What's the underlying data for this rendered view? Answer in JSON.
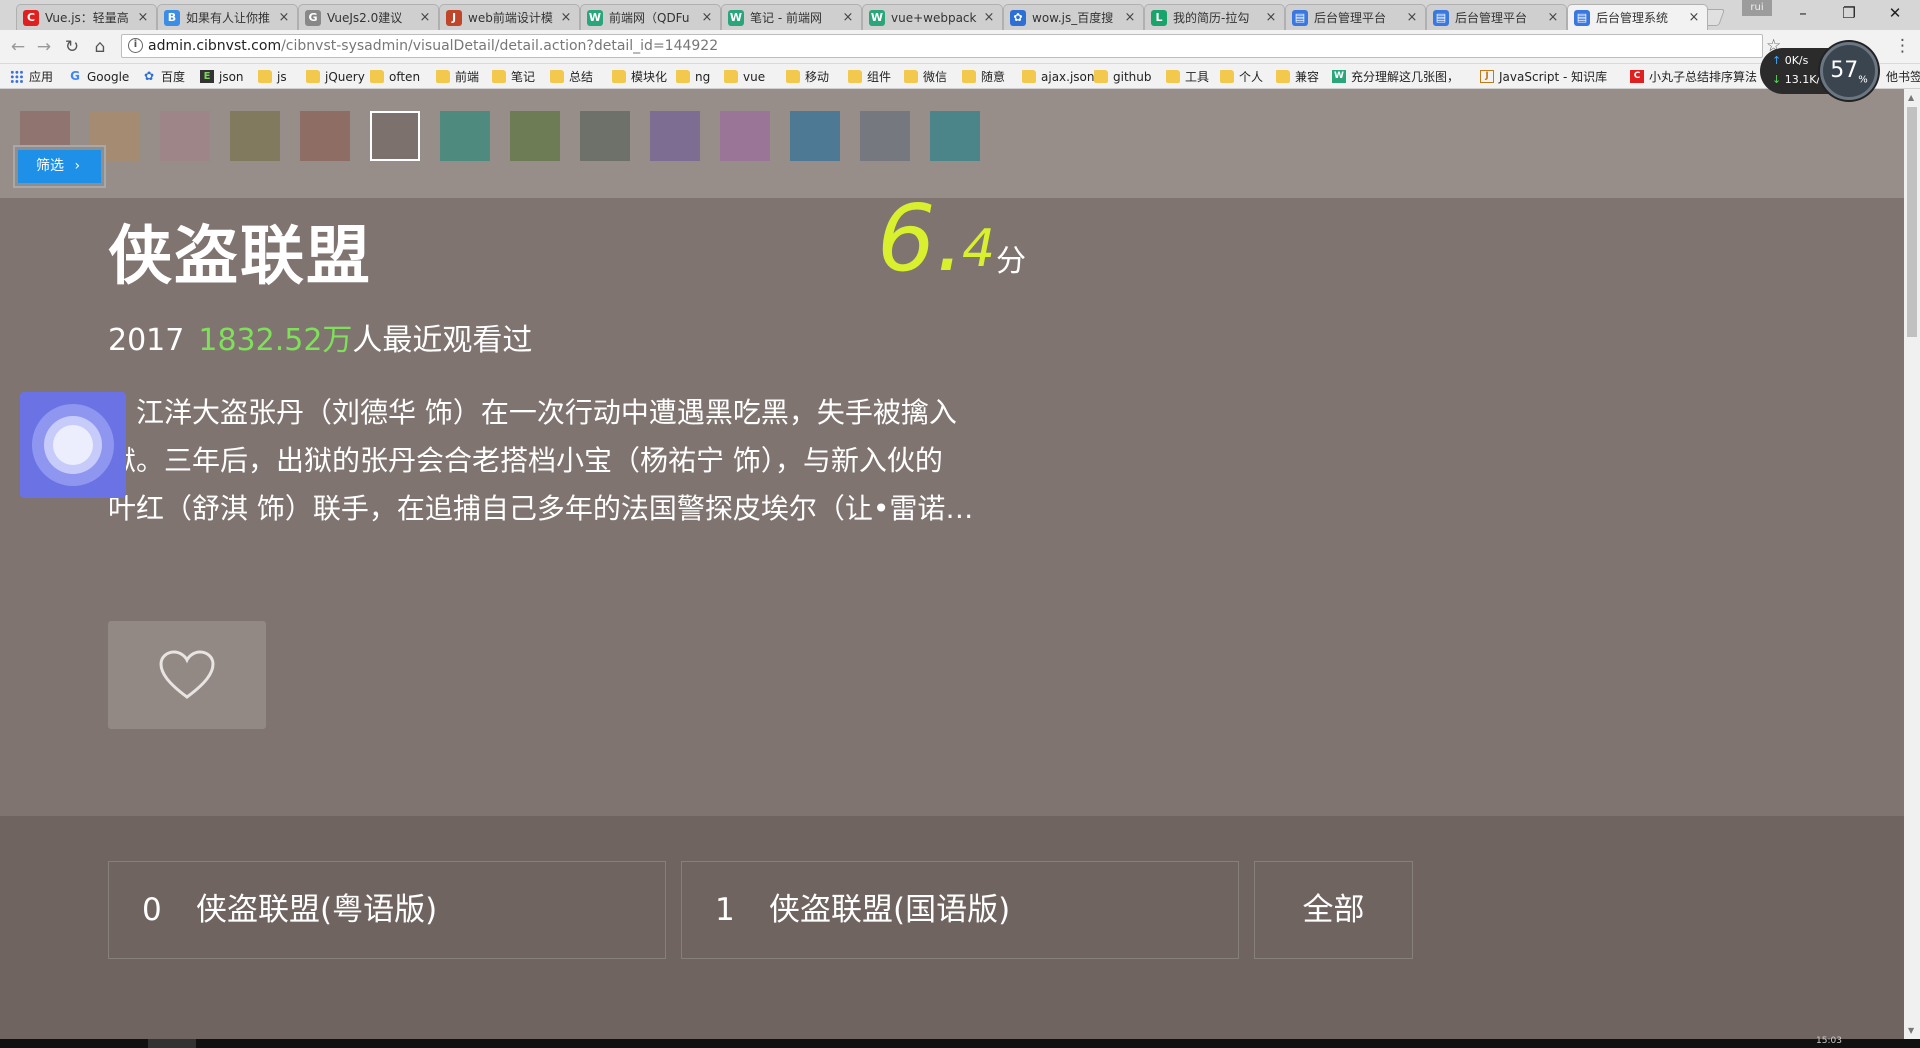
{
  "browser": {
    "tabs": [
      {
        "title": "Vue.js：轻量高",
        "icon": "C",
        "color": "#e02020"
      },
      {
        "title": "如果有人让你推",
        "icon": "B",
        "color": "#3a8ee6"
      },
      {
        "title": "VueJs2.0建议",
        "icon": "G",
        "color": "#888888"
      },
      {
        "title": "web前端设计模",
        "icon": "J",
        "color": "#c0462a"
      },
      {
        "title": "前端网（QDFu",
        "icon": "W",
        "color": "#2aa67a"
      },
      {
        "title": "笔记 - 前端网",
        "icon": "W",
        "color": "#2aa67a"
      },
      {
        "title": "vue+webpack",
        "icon": "W",
        "color": "#2aa67a"
      },
      {
        "title": "wow.js_百度搜",
        "icon": "✿",
        "color": "#2e6fd6"
      },
      {
        "title": "我的简历-拉勾",
        "icon": "L",
        "color": "#1aa36b"
      },
      {
        "title": "后台管理平台",
        "icon": "▤",
        "color": "#3a78e0"
      },
      {
        "title": "后台管理平台",
        "icon": "▤",
        "color": "#3a78e0"
      },
      {
        "title": "后台管理系统",
        "icon": "▤",
        "color": "#3a78e0"
      }
    ],
    "active_tab_index": 11,
    "profile": "rui",
    "url_host": "admin.cibnvst.com",
    "url_path": "/cibnvst-sysadmin/visualDetail/detail.action?detail_id=144922",
    "bookmarks": [
      {
        "label": "应用",
        "type": "apps"
      },
      {
        "label": "Google",
        "type": "google"
      },
      {
        "label": "百度",
        "type": "baidu"
      },
      {
        "label": "json",
        "type": "json"
      },
      {
        "label": "js",
        "type": "folder"
      },
      {
        "label": "jQuery",
        "type": "folder"
      },
      {
        "label": "often",
        "type": "folder"
      },
      {
        "label": "前端",
        "type": "folder"
      },
      {
        "label": "笔记",
        "type": "folder"
      },
      {
        "label": "总结",
        "type": "folder"
      },
      {
        "label": "模块化",
        "type": "folder"
      },
      {
        "label": "ng",
        "type": "folder"
      },
      {
        "label": "vue",
        "type": "folder"
      },
      {
        "label": "移动",
        "type": "folder"
      },
      {
        "label": "组件",
        "type": "folder"
      },
      {
        "label": "微信",
        "type": "folder"
      },
      {
        "label": "随意",
        "type": "folder"
      },
      {
        "label": "ajax.json",
        "type": "folder"
      },
      {
        "label": "github",
        "type": "folder"
      },
      {
        "label": "工具",
        "type": "folder"
      },
      {
        "label": "个人",
        "type": "folder"
      },
      {
        "label": "兼容",
        "type": "folder"
      },
      {
        "label": "充分理解这几张图，",
        "type": "w"
      },
      {
        "label": "JavaScript - 知识库",
        "type": "j"
      },
      {
        "label": "小丸子总结排序算法",
        "type": "c"
      }
    ],
    "bookmarks_overflow": "他书签"
  },
  "speed_widget": {
    "up": "0K/s",
    "down": "13.1K/s",
    "percent": "57",
    "percent_unit": "%"
  },
  "swatches": [
    "#8f7470",
    "#a48b72",
    "#9d8588",
    "#827a5e",
    "#8d6d64",
    "#7d716e",
    "#4f8a7e",
    "#6e7c55",
    "#6e706a",
    "#7d6d92",
    "#9b7597",
    "#4d7995",
    "#767880",
    "#4c8589"
  ],
  "selected_swatch": 5,
  "filter_button": "筛选",
  "movie": {
    "title": "侠盗联盟",
    "score_int": "6.",
    "score_dec": "4",
    "score_unit": "分",
    "year": "2017",
    "views": "1832.52万",
    "views_suffix": "人最近观看过",
    "description_lines": [
      "　江洋大盗张丹（刘德华 饰）在一次行动中遭遇黑吃黑，失手被擒入",
      "狱。三年后，出狱的张丹会合老搭档小宝（杨祐宁 饰），与新入伙的",
      "叶红（舒淇 饰）联手，在追捕自己多年的法国警探皮埃尔（让•雷诺…"
    ]
  },
  "episodes": [
    {
      "num": "0",
      "name": "侠盗联盟(粤语版)"
    },
    {
      "num": "1",
      "name": "侠盗联盟(国语版)"
    }
  ],
  "all_button": "全部",
  "taskbar_clock": "15:03"
}
